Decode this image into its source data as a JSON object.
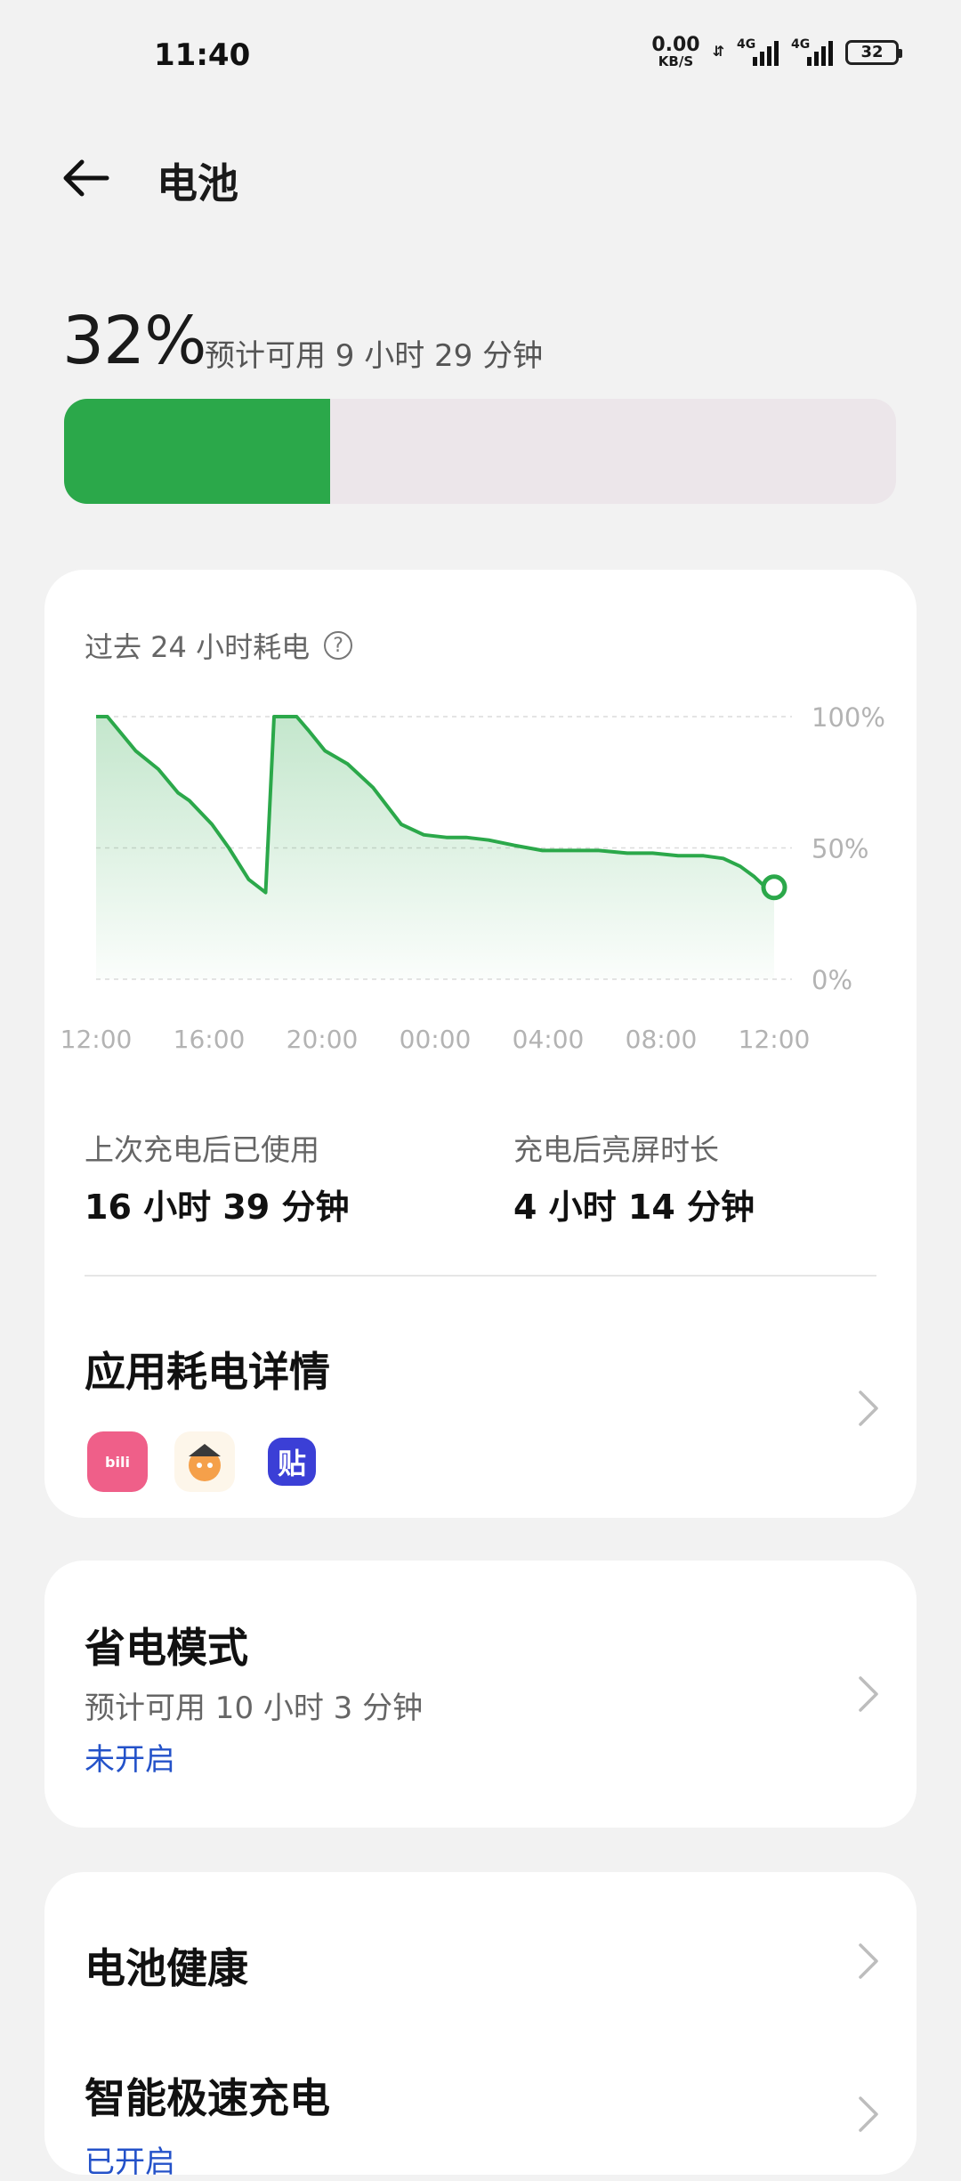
{
  "status_bar": {
    "time": "11:40",
    "net_speed_value": "0.00",
    "net_speed_unit": "KB/S",
    "sim1_type": "4G",
    "sim2_type": "4G",
    "battery_level": "32"
  },
  "header": {
    "title": "电池"
  },
  "summary": {
    "percent": "32%",
    "remaining": "预计可用 9 小时 29 分钟",
    "level_fraction": 0.32
  },
  "usage_card": {
    "title": "过去 24 小时耗电",
    "stats": {
      "since_charge_label": "上次充电后已使用",
      "since_charge_value": "16 小时 39 分钟",
      "screen_on_label": "充电后亮屏时长",
      "screen_on_value": "4 小时 14 分钟"
    },
    "app_usage_title": "应用耗电详情",
    "app_icons": [
      "bilibili-icon",
      "cartoon-character-icon",
      "tieba-icon"
    ]
  },
  "power_saving": {
    "title": "省电模式",
    "subtitle": "预计可用 10 小时 3 分钟",
    "status": "未开启"
  },
  "battery_health": {
    "title": "电池健康"
  },
  "smart_charging": {
    "title": "智能极速充电",
    "status": "已开启"
  },
  "chart_data": {
    "type": "area",
    "ylim": [
      0,
      100
    ],
    "yticks": [
      "100%",
      "50%",
      "0%"
    ],
    "xticks": [
      "12:00",
      "16:00",
      "20:00",
      "00:00",
      "04:00",
      "08:00",
      "12:00"
    ],
    "x_hours": [
      0,
      0.4,
      1.4,
      2.2,
      2.9,
      3.3,
      4.1,
      4.7,
      5.4,
      6.0,
      6.3,
      7.1,
      7.5,
      8.1,
      8.9,
      9.8,
      10.8,
      11.6,
      12.4,
      13.1,
      13.9,
      14.8,
      15.8,
      16.9,
      17.8,
      18.8,
      19.7,
      20.6,
      21.5,
      22.2,
      22.8,
      23.3,
      23.7,
      24
    ],
    "values": [
      100,
      100,
      87,
      80,
      71,
      68,
      59,
      50,
      38,
      33,
      100,
      100,
      95,
      87,
      82,
      73,
      59,
      55,
      54,
      54,
      53,
      51,
      49,
      49,
      49,
      48,
      48,
      47,
      47,
      46,
      43,
      39,
      35,
      35
    ],
    "xlabel": "",
    "ylabel": ""
  },
  "colors": {
    "accent_green": "#2ba84a",
    "link_blue": "#2452c9",
    "bar_track": "#ece6ea"
  }
}
